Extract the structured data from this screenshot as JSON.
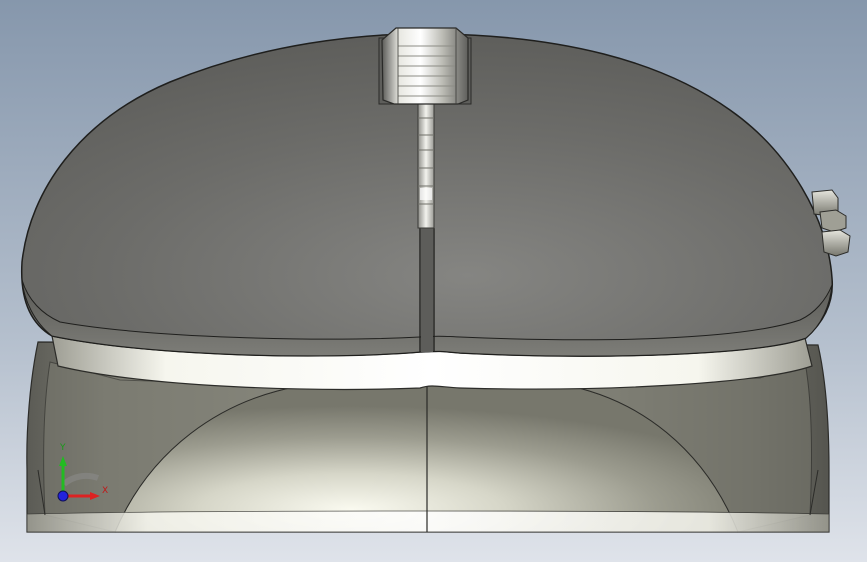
{
  "viewport": {
    "colors": {
      "background_top": "#8798ad",
      "background_bottom": "#dde2ea",
      "shell_top": "#6c6c68",
      "shell_light": "#c9c9c0",
      "edge_band": "#f4f4ec",
      "axis_x": "#e02020",
      "axis_y": "#20c020",
      "axis_z": "#2020e0"
    },
    "triad": {
      "x_label": "X",
      "y_label": "Y",
      "z_label": ""
    }
  }
}
